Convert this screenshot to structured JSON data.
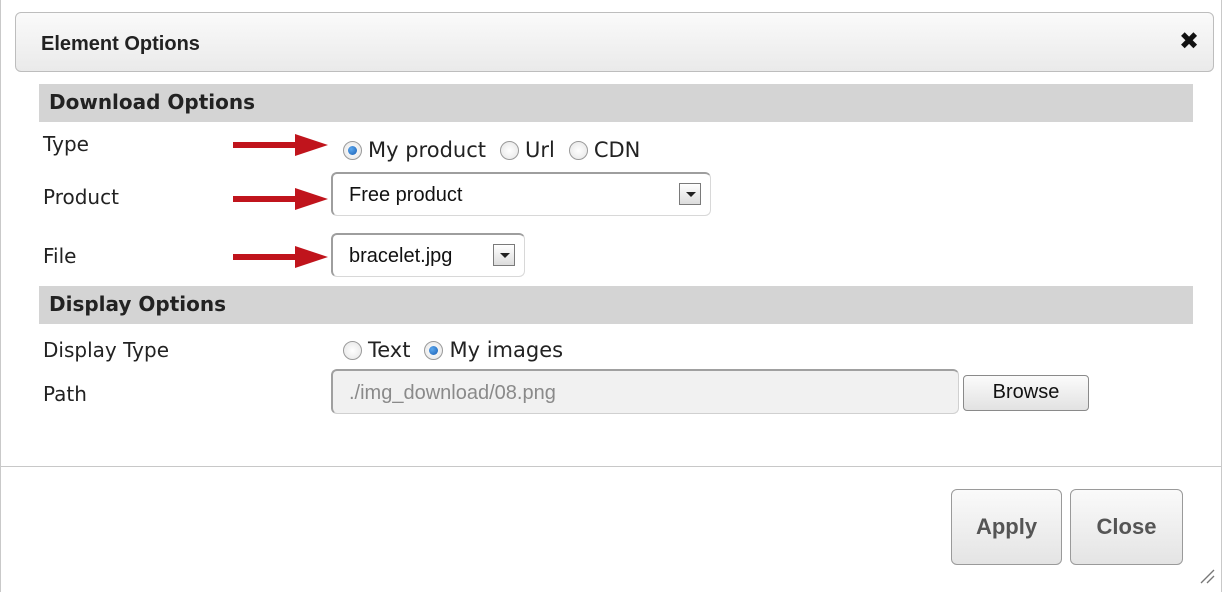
{
  "window": {
    "title": "Element Options"
  },
  "download_options": {
    "header": "Download Options",
    "type": {
      "label": "Type",
      "options": [
        {
          "label": "My product",
          "checked": true
        },
        {
          "label": "Url",
          "checked": false
        },
        {
          "label": "CDN",
          "checked": false
        }
      ]
    },
    "product": {
      "label": "Product",
      "value": "Free product"
    },
    "file": {
      "label": "File",
      "value": "bracelet.jpg"
    }
  },
  "display_options": {
    "header": "Display Options",
    "display_type": {
      "label": "Display Type",
      "options": [
        {
          "label": "Text",
          "checked": false
        },
        {
          "label": "My images",
          "checked": true
        }
      ]
    },
    "path": {
      "label": "Path",
      "value": "./img_download/08.png",
      "browse_label": "Browse"
    }
  },
  "footer": {
    "apply_label": "Apply",
    "close_label": "Close"
  },
  "colors": {
    "annotation_arrow": "#c0141c",
    "section_header_bg": "#d4d4d4"
  },
  "icons": {
    "close": "close-icon",
    "resize": "resize-grip-icon",
    "dropdown": "chevron-down-icon"
  }
}
